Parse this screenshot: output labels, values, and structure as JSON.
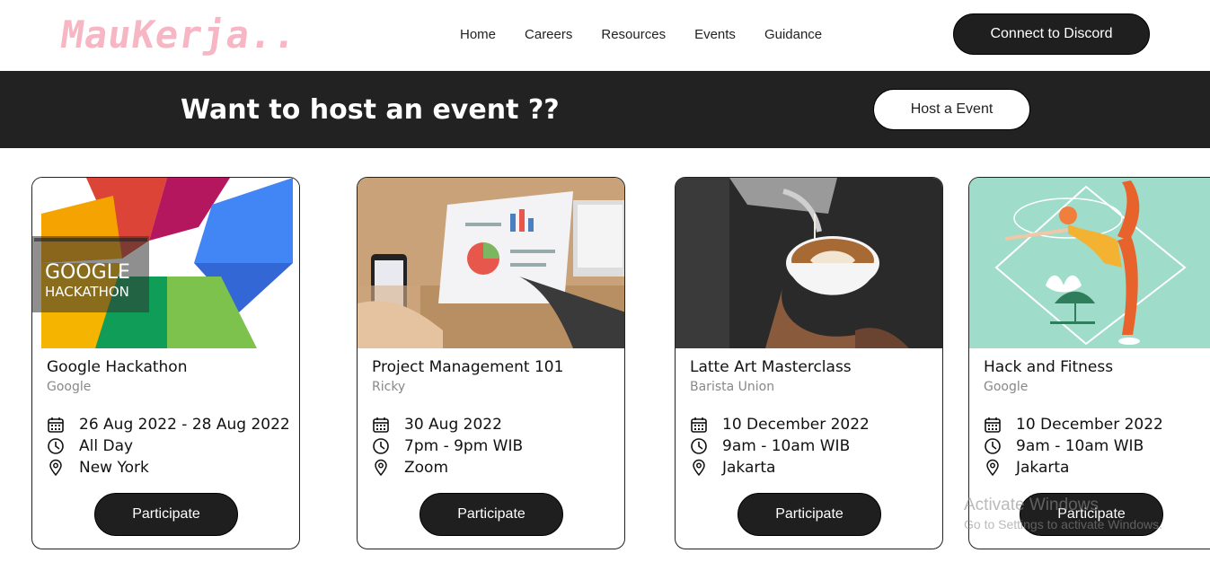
{
  "header": {
    "logo": "MauKerja..",
    "nav": [
      "Home",
      "Careers",
      "Resources",
      "Events",
      "Guidance"
    ],
    "discord_label": "Connect to Discord"
  },
  "banner": {
    "title": "Want to host an event ??",
    "host_label": "Host a Event"
  },
  "cards": [
    {
      "title": "Google Hackathon",
      "org": "Google",
      "date": "26 Aug 2022 - 28 Aug 2022",
      "time": "All Day",
      "location": "New York",
      "button": "Participate",
      "image_text_1": "GOOGLE",
      "image_text_2": "HACKATHON"
    },
    {
      "title": "Project Management 101",
      "org": "Ricky",
      "date": "30 Aug 2022",
      "time": "7pm - 9pm WIB",
      "location": "Zoom",
      "button": "Participate"
    },
    {
      "title": "Latte Art Masterclass",
      "org": "Barista Union",
      "date": "10 December 2022",
      "time": "9am - 10am WIB",
      "location": "Jakarta",
      "button": "Participate"
    },
    {
      "title": "Hack and Fitness",
      "org": "Google",
      "date": "10 December 2022",
      "time": "9am - 10am WIB",
      "location": "Jakarta",
      "button": "Participate"
    }
  ],
  "watermark": {
    "line1": "Activate Windows",
    "line2": "Go to Settings to activate Windows."
  },
  "icons": [
    "calendar-icon",
    "clock-icon",
    "location-pin-icon"
  ],
  "colors": {
    "dark": "#222222",
    "logo_pink": "#f7b6c4",
    "muted": "#888888"
  }
}
